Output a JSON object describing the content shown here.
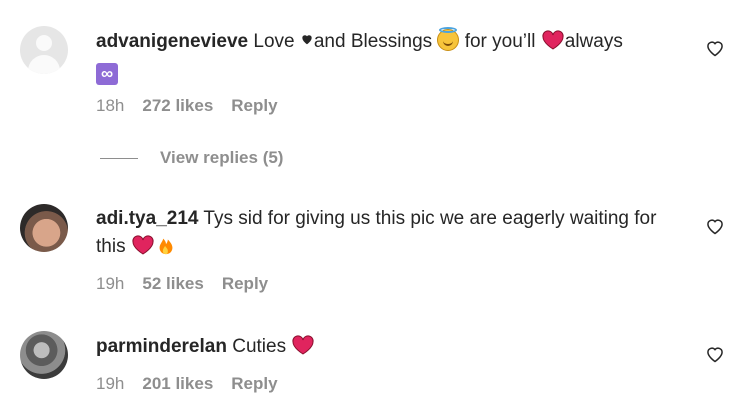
{
  "comments": [
    {
      "username": "advanigenevieve",
      "text_parts": [
        "Love ",
        "and Blessings ",
        " for you’ll ",
        "always"
      ],
      "icons": [
        "black-heart-icon",
        "smiling-face-with-halo-icon",
        "red-heart-icon",
        "infinity-icon"
      ],
      "time": "18h",
      "likes": "272 likes",
      "reply": "Reply"
    },
    {
      "username": "adi.tya_214",
      "text": "Tys sid for giving us this pic we are eagerly waiting for this",
      "icons": [
        "red-heart-icon",
        "fire-icon"
      ],
      "time": "19h",
      "likes": "52 likes",
      "reply": "Reply"
    },
    {
      "username": "parminderelan",
      "text": "Cuties",
      "icons": [
        "red-heart-icon"
      ],
      "time": "19h",
      "likes": "201 likes",
      "reply": "Reply"
    }
  ],
  "view_replies": "View replies (5)",
  "colors": {
    "text": "#262626",
    "muted": "#8e8e8e",
    "heart": "#e0245e"
  },
  "icons": {
    "like": "heart-outline-icon"
  }
}
